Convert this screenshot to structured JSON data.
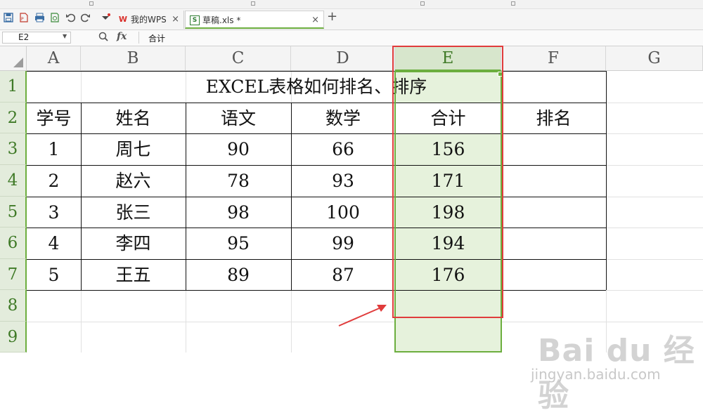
{
  "tabbar": {
    "tabs": [
      {
        "label": "我的WPS",
        "close": "×"
      },
      {
        "label": "草稿.xls *",
        "close": "×"
      }
    ],
    "add": "+"
  },
  "formula_bar": {
    "cell_ref": "E2",
    "fx": "fx",
    "content": "合计"
  },
  "grid": {
    "columns": [
      "A",
      "B",
      "C",
      "D",
      "E",
      "F",
      "G"
    ],
    "rows": [
      "1",
      "2",
      "3",
      "4",
      "5",
      "6",
      "7",
      "8",
      "9"
    ],
    "selected_column": "E",
    "title": "EXCEL表格如何排名、排序",
    "headers": [
      "学号",
      "姓名",
      "语文",
      "数学",
      "合计",
      "排名"
    ],
    "data": [
      [
        "1",
        "周七",
        "90",
        "66",
        "156",
        ""
      ],
      [
        "2",
        "赵六",
        "78",
        "93",
        "171",
        ""
      ],
      [
        "3",
        "张三",
        "98",
        "100",
        "198",
        ""
      ],
      [
        "4",
        "李四",
        "95",
        "99",
        "194",
        ""
      ],
      [
        "5",
        "王五",
        "89",
        "87",
        "176",
        ""
      ]
    ]
  },
  "watermark": {
    "logo": "Bai du 经验",
    "url": "jingyan.baidu.com"
  },
  "colors": {
    "accent_green": "#6cae3e",
    "selection_fill": "#e6f2dc",
    "annotation_red": "#e03c3c",
    "wps_red": "#d9302b"
  },
  "icons": [
    "save-icon",
    "export-pdf-icon",
    "print-icon",
    "print-preview-icon",
    "undo-icon",
    "redo-icon",
    "customize-icon",
    "wps-logo-icon",
    "excel-file-icon",
    "zoom-icon",
    "fx-icon",
    "select-all-icon"
  ]
}
